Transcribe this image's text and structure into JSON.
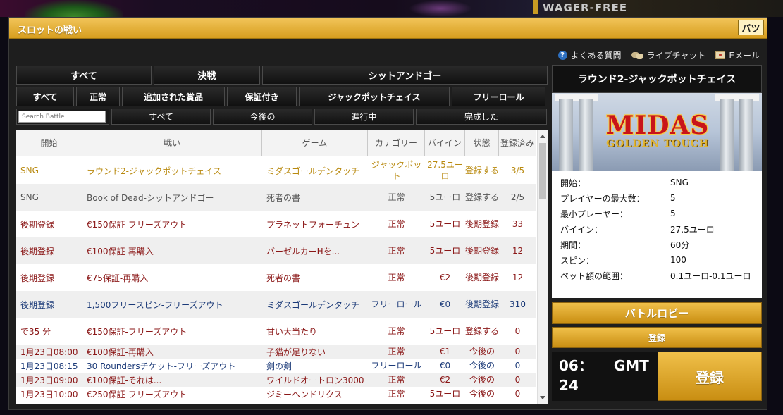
{
  "background": {
    "banner_text": "WAGER-FREE"
  },
  "modal": {
    "title": "スロットの戦い",
    "close_label": "バツ"
  },
  "top_links": [
    {
      "label": "よくある質問",
      "icon": "help-icon"
    },
    {
      "label": "ライブチャット",
      "icon": "chat-icon"
    },
    {
      "label": "Eメール",
      "icon": "mail-icon"
    }
  ],
  "filters": {
    "row1": [
      "すべて",
      "決戦",
      "シットアンドゴー"
    ],
    "row2": [
      "すべて",
      "正常",
      "追加された賞品",
      "保証付き",
      "ジャックポットチェイス",
      "フリーロール"
    ],
    "search_placeholder": "Search Battle",
    "row3": [
      "すべて",
      "今後の",
      "進行中",
      "完成した"
    ]
  },
  "table": {
    "headers": [
      "開始",
      "戦い",
      "ゲーム",
      "カテゴリー",
      "バイイン",
      "状態",
      "登録済み"
    ],
    "rows": [
      {
        "start": "SNG",
        "battle": "ラウンド2-ジャックポットチェイス",
        "game": "ミダスゴールデンタッチ",
        "category": "ジャックポット",
        "buyin": "27.5ユーロ",
        "status": "登録する",
        "registered": "3/5",
        "color": "gold"
      },
      {
        "start": "SNG",
        "battle": "Book of Dead-シットアンドゴー",
        "game": "死者の書",
        "category": "正常",
        "buyin": "5ユーロ",
        "status": "登録する",
        "registered": "2/5",
        "color": "gray"
      },
      {
        "start": "後期登録",
        "battle": "€150保証-フリーズアウト",
        "game": "プラネットフォーチュン",
        "category": "正常",
        "buyin": "5ユーロ",
        "status": "後期登録",
        "registered": "33",
        "color": "red"
      },
      {
        "start": "後期登録",
        "battle": "€100保証-再購入",
        "game": "バーゼルカーHを...",
        "category": "正常",
        "buyin": "5ユーロ",
        "status": "後期登録",
        "registered": "12",
        "color": "red"
      },
      {
        "start": "後期登録",
        "battle": "€75保証-再購入",
        "game": "死者の書",
        "category": "正常",
        "buyin": "€2",
        "status": "後期登録",
        "registered": "12",
        "color": "red"
      },
      {
        "start": "後期登録",
        "battle": "1,500フリースピン-フリーズアウト",
        "game": "ミダスゴールデンタッチ",
        "category": "フリーロール",
        "buyin": "€0",
        "status": "後期登録",
        "registered": "310",
        "color": "navy"
      },
      {
        "start": "で35 分",
        "battle": "€150保証-フリーズアウト",
        "game": "甘い大当たり",
        "category": "正常",
        "buyin": "5ユーロ",
        "status": "登録する",
        "registered": "0",
        "color": "red"
      },
      {
        "start": "1月23日08:00",
        "battle": "€100保証-再購入",
        "game": "子猫が足りない",
        "category": "正常",
        "buyin": "€1",
        "status": "今後の",
        "registered": "0",
        "color": "red"
      },
      {
        "start": "1月23日08:15",
        "battle": "30 Roundersチケット-フリーズアウト",
        "game": "剣の剣",
        "category": "フリーロール",
        "buyin": "€0",
        "status": "今後の",
        "registered": "0",
        "color": "navy"
      },
      {
        "start": "1月23日09:00",
        "battle": "€100保証-それは...",
        "game": "ワイルドオートロン3000",
        "category": "正常",
        "buyin": "€2",
        "status": "今後の",
        "registered": "0",
        "color": "red"
      },
      {
        "start": "1月23日10:00",
        "battle": "€250保証-フリーズアウト",
        "game": "ジミーヘンドリクス",
        "category": "正常",
        "buyin": "5ユーロ",
        "status": "今後の",
        "registered": "0",
        "color": "red"
      }
    ]
  },
  "details": {
    "title": "ラウンド2-ジャックポットチェイス",
    "banner_main": "MIDAS",
    "banner_sub": "GOLDEN TOUCH",
    "info": [
      {
        "label": "開始：",
        "value": "SNG"
      },
      {
        "label": "プレイヤーの最大数：",
        "value": "5"
      },
      {
        "label": "最小プレーヤー：",
        "value": "5"
      },
      {
        "label": "バイイン：",
        "value": "27.5ユーロ"
      },
      {
        "label": "期間：",
        "value": "60分"
      },
      {
        "label": "スピン：",
        "value": "100"
      },
      {
        "label": "ベット額の範囲：",
        "value": "0.1ユーロ-0.1ユーロ"
      }
    ],
    "lobby_label": "バトルロビー",
    "register_small_label": "登録",
    "timer_line1": "06：",
    "timer_gmt": "GMT",
    "timer_line2": "24",
    "register_big_label": "登録"
  }
}
